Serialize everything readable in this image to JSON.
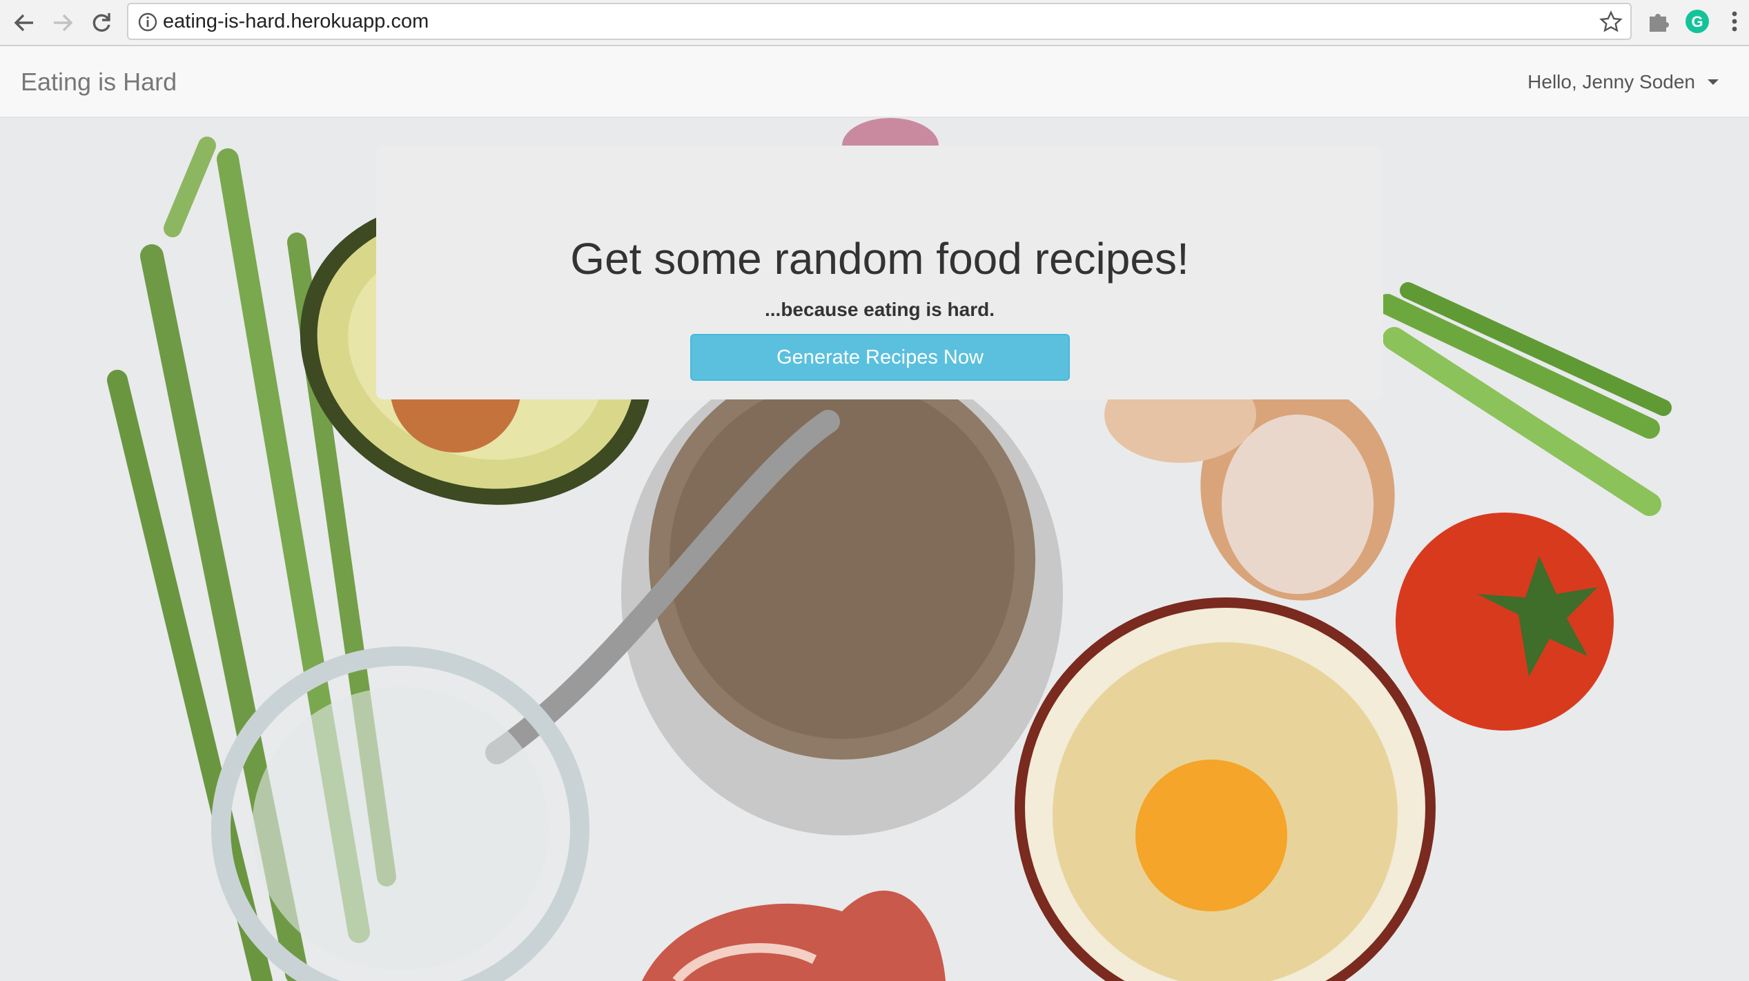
{
  "browser": {
    "url": "eating-is-hard.herokuapp.com"
  },
  "navbar": {
    "brand": "Eating is Hard",
    "user_greeting": "Hello, Jenny Soden"
  },
  "hero": {
    "title": "Get some random food recipes!",
    "subtitle": "...because eating is hard.",
    "button_label": "Generate Recipes Now",
    "accent_color": "#5bc0de"
  },
  "icons": [
    "back-arrow-icon",
    "forward-arrow-icon",
    "reload-icon",
    "info-icon",
    "star-icon",
    "extension-icon",
    "grammarly-icon",
    "menu-dots-icon",
    "caret-down-icon"
  ]
}
